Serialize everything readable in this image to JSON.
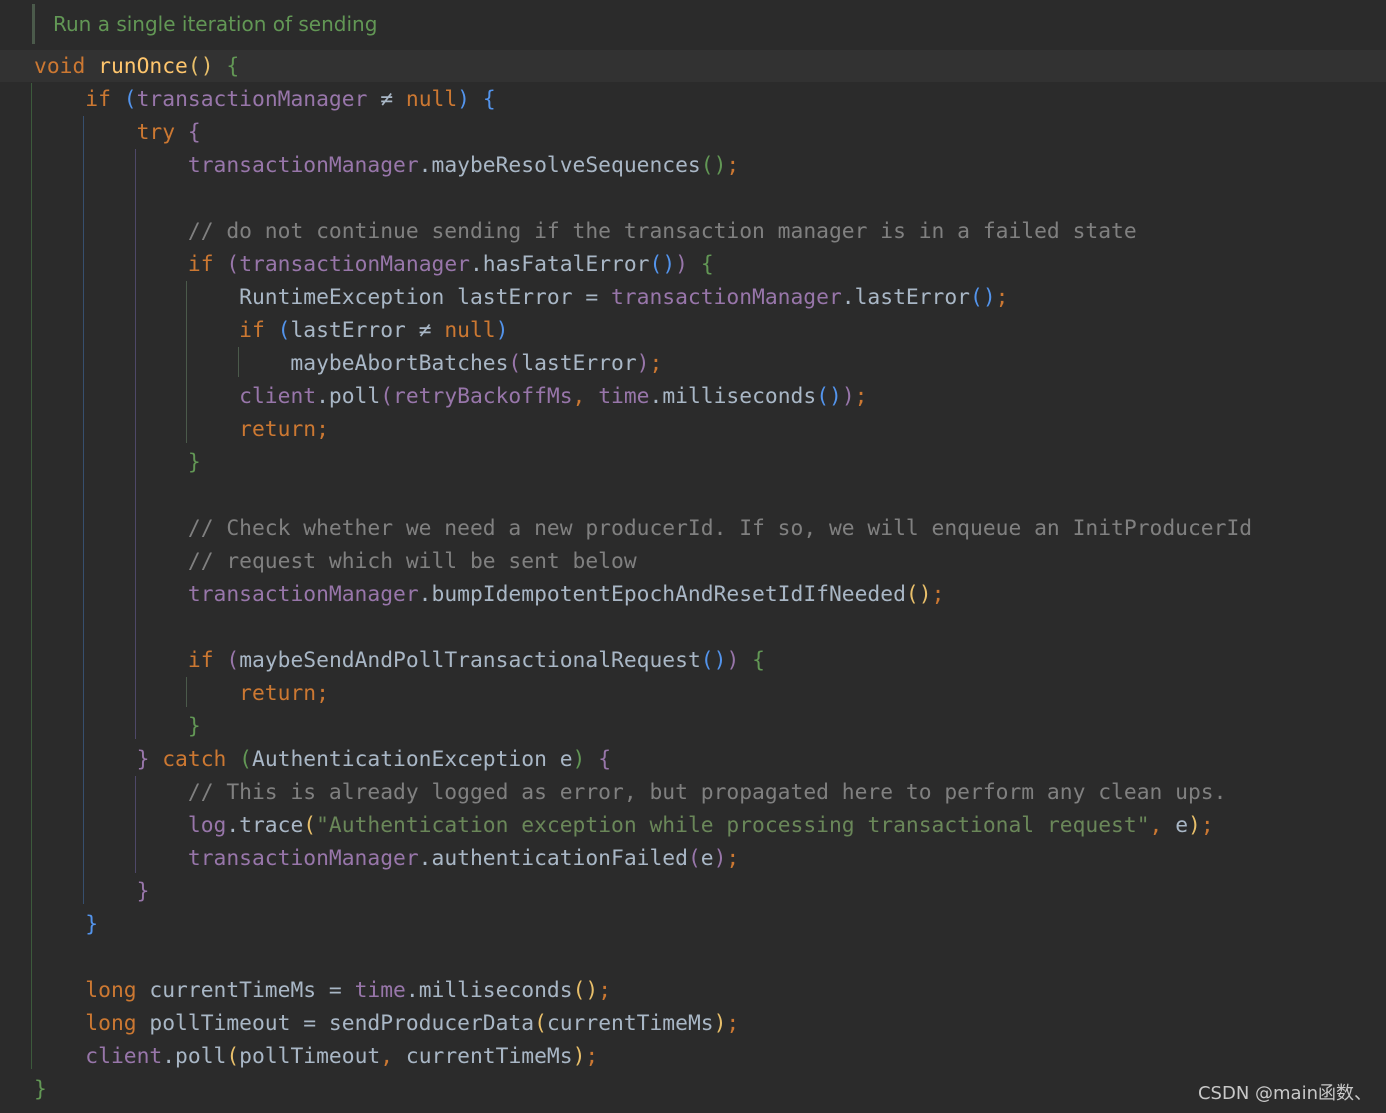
{
  "editor": {
    "doc_comment": "Run a single iteration of sending",
    "code_lines": [
      [
        {
          "t": "void",
          "c": "kw"
        },
        {
          "t": " "
        },
        {
          "t": "runOnce",
          "c": "fn"
        },
        {
          "t": "()",
          "c": "b1"
        },
        {
          "t": " "
        },
        {
          "t": "{",
          "c": "b3"
        }
      ],
      [
        {
          "t": "    "
        },
        {
          "t": "if",
          "c": "kw"
        },
        {
          "t": " "
        },
        {
          "t": "(",
          "c": "b2"
        },
        {
          "t": "transactionManager",
          "c": "fld"
        },
        {
          "t": " ≠ "
        },
        {
          "t": "null",
          "c": "kw"
        },
        {
          "t": ")",
          "c": "b2"
        },
        {
          "t": " "
        },
        {
          "t": "{",
          "c": "b2"
        }
      ],
      [
        {
          "t": "        "
        },
        {
          "t": "try",
          "c": "kw"
        },
        {
          "t": " "
        },
        {
          "t": "{",
          "c": "b4"
        }
      ],
      [
        {
          "t": "            "
        },
        {
          "t": "transactionManager",
          "c": "fld"
        },
        {
          "t": ".maybeResolveSequences"
        },
        {
          "t": "()",
          "c": "b3"
        },
        {
          "t": ";",
          "c": "pu"
        }
      ],
      [],
      [
        {
          "t": "            "
        },
        {
          "t": "// do not continue sending if the transaction manager is in a failed state",
          "c": "cm"
        }
      ],
      [
        {
          "t": "            "
        },
        {
          "t": "if",
          "c": "kw"
        },
        {
          "t": " "
        },
        {
          "t": "(",
          "c": "b4"
        },
        {
          "t": "transactionManager",
          "c": "fld"
        },
        {
          "t": ".hasFatalError"
        },
        {
          "t": "()",
          "c": "b2"
        },
        {
          "t": ")",
          "c": "b4"
        },
        {
          "t": " "
        },
        {
          "t": "{",
          "c": "b3"
        }
      ],
      [
        {
          "t": "                RuntimeException lastError = "
        },
        {
          "t": "transactionManager",
          "c": "fld"
        },
        {
          "t": ".lastError"
        },
        {
          "t": "()",
          "c": "b2"
        },
        {
          "t": ";",
          "c": "pu"
        }
      ],
      [
        {
          "t": "                "
        },
        {
          "t": "if",
          "c": "kw"
        },
        {
          "t": " "
        },
        {
          "t": "(",
          "c": "b2"
        },
        {
          "t": "lastError ≠ "
        },
        {
          "t": "null",
          "c": "kw"
        },
        {
          "t": ")",
          "c": "b2"
        }
      ],
      [
        {
          "t": "                    maybeAbortBatches"
        },
        {
          "t": "(",
          "c": "b4"
        },
        {
          "t": "lastError"
        },
        {
          "t": ")",
          "c": "b4"
        },
        {
          "t": ";",
          "c": "pu"
        }
      ],
      [
        {
          "t": "                "
        },
        {
          "t": "client",
          "c": "fld"
        },
        {
          "t": ".poll"
        },
        {
          "t": "(",
          "c": "b4"
        },
        {
          "t": "retryBackoffMs",
          "c": "fld"
        },
        {
          "t": ", ",
          "c": "pu"
        },
        {
          "t": "time",
          "c": "fld"
        },
        {
          "t": ".milliseconds"
        },
        {
          "t": "()",
          "c": "b2"
        },
        {
          "t": ")",
          "c": "b4"
        },
        {
          "t": ";",
          "c": "pu"
        }
      ],
      [
        {
          "t": "                "
        },
        {
          "t": "return",
          "c": "kw"
        },
        {
          "t": ";",
          "c": "pu"
        }
      ],
      [
        {
          "t": "            "
        },
        {
          "t": "}",
          "c": "b3"
        }
      ],
      [],
      [
        {
          "t": "            "
        },
        {
          "t": "// Check whether we need a new producerId. If so, we will enqueue an InitProducerId",
          "c": "cm"
        }
      ],
      [
        {
          "t": "            "
        },
        {
          "t": "// request which will be sent below",
          "c": "cm"
        }
      ],
      [
        {
          "t": "            "
        },
        {
          "t": "transactionManager",
          "c": "fld"
        },
        {
          "t": ".bumpIdempotentEpochAndResetIdIfNeeded"
        },
        {
          "t": "()",
          "c": "b1"
        },
        {
          "t": ";",
          "c": "pu"
        }
      ],
      [],
      [
        {
          "t": "            "
        },
        {
          "t": "if",
          "c": "kw"
        },
        {
          "t": " "
        },
        {
          "t": "(",
          "c": "b4"
        },
        {
          "t": "maybeSendAndPollTransactionalRequest"
        },
        {
          "t": "()",
          "c": "b2"
        },
        {
          "t": ")",
          "c": "b4"
        },
        {
          "t": " "
        },
        {
          "t": "{",
          "c": "b3"
        }
      ],
      [
        {
          "t": "                "
        },
        {
          "t": "return",
          "c": "kw"
        },
        {
          "t": ";",
          "c": "pu"
        }
      ],
      [
        {
          "t": "            "
        },
        {
          "t": "}",
          "c": "b3"
        }
      ],
      [
        {
          "t": "        "
        },
        {
          "t": "}",
          "c": "b4"
        },
        {
          "t": " "
        },
        {
          "t": "catch",
          "c": "kw"
        },
        {
          "t": " "
        },
        {
          "t": "(",
          "c": "b3"
        },
        {
          "t": "AuthenticationException e"
        },
        {
          "t": ")",
          "c": "b3"
        },
        {
          "t": " "
        },
        {
          "t": "{",
          "c": "b4"
        }
      ],
      [
        {
          "t": "            "
        },
        {
          "t": "// This is already logged as error, but propagated here to perform any clean ups.",
          "c": "cm"
        }
      ],
      [
        {
          "t": "            "
        },
        {
          "t": "log",
          "c": "fld"
        },
        {
          "t": ".trace"
        },
        {
          "t": "(",
          "c": "b1"
        },
        {
          "t": "\"Authentication exception while processing transactional request\"",
          "c": "st"
        },
        {
          "t": ", ",
          "c": "pu"
        },
        {
          "t": "e"
        },
        {
          "t": ")",
          "c": "b1"
        },
        {
          "t": ";",
          "c": "pu"
        }
      ],
      [
        {
          "t": "            "
        },
        {
          "t": "transactionManager",
          "c": "fld"
        },
        {
          "t": ".authenticationFailed"
        },
        {
          "t": "(",
          "c": "b4"
        },
        {
          "t": "e"
        },
        {
          "t": ")",
          "c": "b4"
        },
        {
          "t": ";",
          "c": "pu"
        }
      ],
      [
        {
          "t": "        "
        },
        {
          "t": "}",
          "c": "b4"
        }
      ],
      [
        {
          "t": "    "
        },
        {
          "t": "}",
          "c": "b2"
        }
      ],
      [],
      [
        {
          "t": "    "
        },
        {
          "t": "long",
          "c": "kw"
        },
        {
          "t": " currentTimeMs = "
        },
        {
          "t": "time",
          "c": "fld"
        },
        {
          "t": ".milliseconds"
        },
        {
          "t": "()",
          "c": "b1"
        },
        {
          "t": ";",
          "c": "pu"
        }
      ],
      [
        {
          "t": "    "
        },
        {
          "t": "long",
          "c": "kw"
        },
        {
          "t": " pollTimeout = sendProducerData"
        },
        {
          "t": "(",
          "c": "b1"
        },
        {
          "t": "currentTimeMs"
        },
        {
          "t": ")",
          "c": "b1"
        },
        {
          "t": ";",
          "c": "pu"
        }
      ],
      [
        {
          "t": "    "
        },
        {
          "t": "client",
          "c": "fld"
        },
        {
          "t": ".poll"
        },
        {
          "t": "(",
          "c": "b1"
        },
        {
          "t": "pollTimeout"
        },
        {
          "t": ", ",
          "c": "pu"
        },
        {
          "t": "currentTimeMs"
        },
        {
          "t": ")",
          "c": "b1"
        },
        {
          "t": ";",
          "c": "pu"
        }
      ],
      [
        {
          "t": "}",
          "c": "b3"
        }
      ]
    ]
  },
  "watermark": "CSDN @main函数、"
}
